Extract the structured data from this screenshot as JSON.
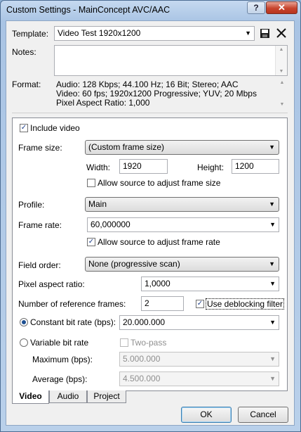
{
  "window": {
    "title": "Custom Settings - MainConcept AVC/AAC"
  },
  "template": {
    "label": "Template:",
    "value": "Video Test 1920x1200"
  },
  "notes": {
    "label": "Notes:",
    "value": ""
  },
  "format": {
    "label": "Format:",
    "lines": [
      "Audio: 128 Kbps; 44.100 Hz; 16 Bit; Stereo; AAC",
      "Video: 60 fps; 1920x1200 Progressive; YUV; 20 Mbps",
      "Pixel Aspect Ratio: 1,000"
    ]
  },
  "video": {
    "include_video": {
      "label": "Include video",
      "checked": true
    },
    "frame_size": {
      "label": "Frame size:",
      "value": "(Custom frame size)"
    },
    "width": {
      "label": "Width:",
      "value": "1920"
    },
    "height": {
      "label": "Height:",
      "value": "1200"
    },
    "allow_frame_size": {
      "label": "Allow source to adjust frame size",
      "checked": false
    },
    "profile": {
      "label": "Profile:",
      "value": "Main"
    },
    "frame_rate": {
      "label": "Frame rate:",
      "value": "60,000000"
    },
    "allow_frame_rate": {
      "label": "Allow source to adjust frame rate",
      "checked": true
    },
    "field_order": {
      "label": "Field order:",
      "value": "None (progressive scan)"
    },
    "pixel_aspect": {
      "label": "Pixel aspect ratio:",
      "value": "1,0000"
    },
    "ref_frames": {
      "label": "Number of reference frames:",
      "value": "2"
    },
    "deblocking": {
      "label": "Use deblocking filter",
      "checked": true
    },
    "cbr": {
      "label": "Constant bit rate (bps):",
      "value": "20.000.000",
      "selected": true
    },
    "vbr": {
      "label": "Variable bit rate",
      "selected": false
    },
    "two_pass": {
      "label": "Two-pass",
      "checked": false
    },
    "maximum": {
      "label": "Maximum (bps):",
      "value": "5.000.000"
    },
    "average": {
      "label": "Average (bps):",
      "value": "4.500.000"
    }
  },
  "tabs": [
    "Video",
    "Audio",
    "Project"
  ],
  "buttons": {
    "ok": "OK",
    "cancel": "Cancel"
  },
  "icons": {
    "save": "save-icon",
    "delete": "delete-x-icon",
    "check": "✓"
  }
}
